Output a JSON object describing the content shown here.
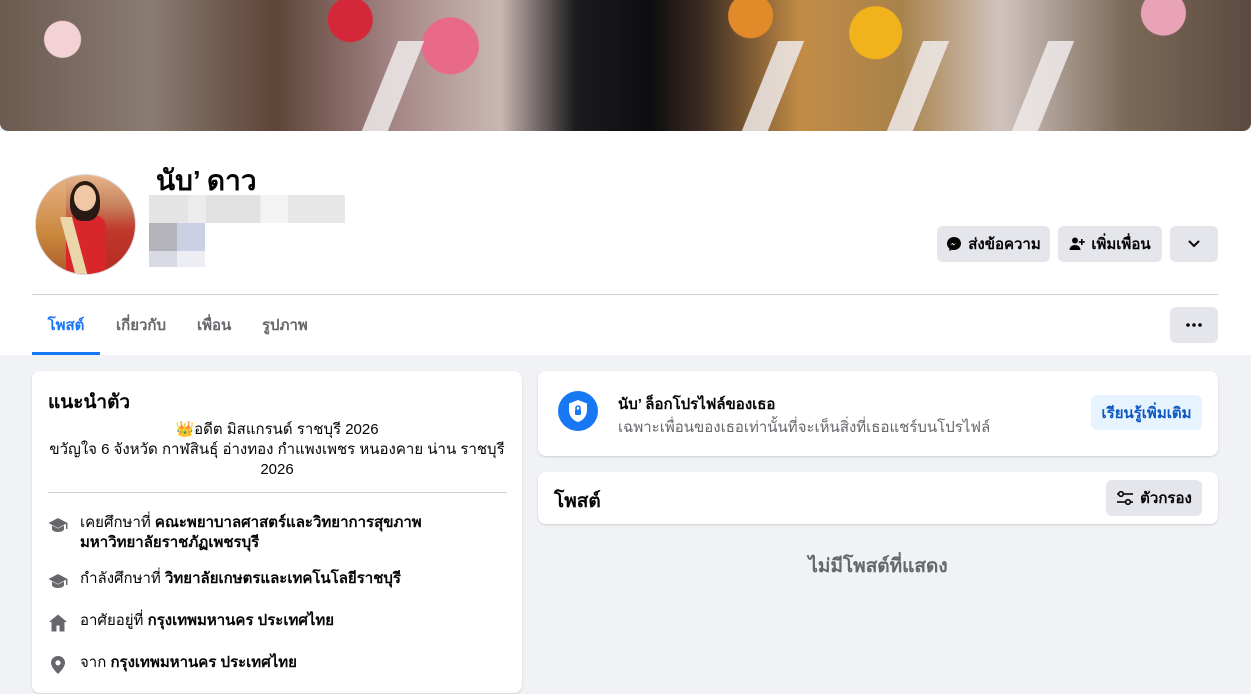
{
  "profile": {
    "name": "นับ’ ดาว"
  },
  "actions": {
    "message_label": "ส่งข้อความ",
    "add_friend_label": "เพิ่มเพื่อน"
  },
  "tabs": [
    {
      "label": "โพสต์",
      "active": true
    },
    {
      "label": "เกี่ยวกับ",
      "active": false
    },
    {
      "label": "เพื่อน",
      "active": false
    },
    {
      "label": "รูปภาพ",
      "active": false
    }
  ],
  "intro": {
    "title": "แนะนำตัว",
    "bio_line1": "👑อดีต มิสแกรนด์ ราชบุรี 2026",
    "bio_line2": "ขวัญใจ 6 จังหวัด กาฬสินธุ์ อ่างทอง กำแพงเพชร หนองคาย น่าน ราชบุรี 2026",
    "details": [
      {
        "icon": "graduation-cap-icon",
        "prefix": "เคยศึกษาที่ ",
        "value": "คณะพยาบาลศาสตร์และวิทยาการสุขภาพ มหาวิทยาลัยราชภัฏเพชรบุรี"
      },
      {
        "icon": "graduation-cap-icon",
        "prefix": "กำลังศึกษาที่ ",
        "value": "วิทยาลัยเกษตรและเทคโนโลยีราชบุรี"
      },
      {
        "icon": "home-icon",
        "prefix": "อาศัยอยู่ที่ ",
        "value": "กรุงเทพมหานคร ประเทศไทย"
      },
      {
        "icon": "location-pin-icon",
        "prefix": "จาก ",
        "value": "กรุงเทพมหานคร ประเทศไทย"
      }
    ]
  },
  "lock_notice": {
    "title": "นับ’ ล็อกโปรไฟล์ของเธอ",
    "subtitle": "เฉพาะเพื่อนของเธอเท่านั้นที่จะเห็นสิ่งที่เธอแชร์บนโปรไฟล์",
    "learn_more_label": "เรียนรู้เพิ่มเติม"
  },
  "posts": {
    "title": "โพสต์",
    "filter_label": "ตัวกรอง",
    "empty_text": "ไม่มีโพสต์ที่แสดง"
  },
  "colors": {
    "accent": "#1877f2",
    "background": "#f0f2f5",
    "button_gray": "#e4e6eb",
    "secondary_text": "#65676b"
  }
}
